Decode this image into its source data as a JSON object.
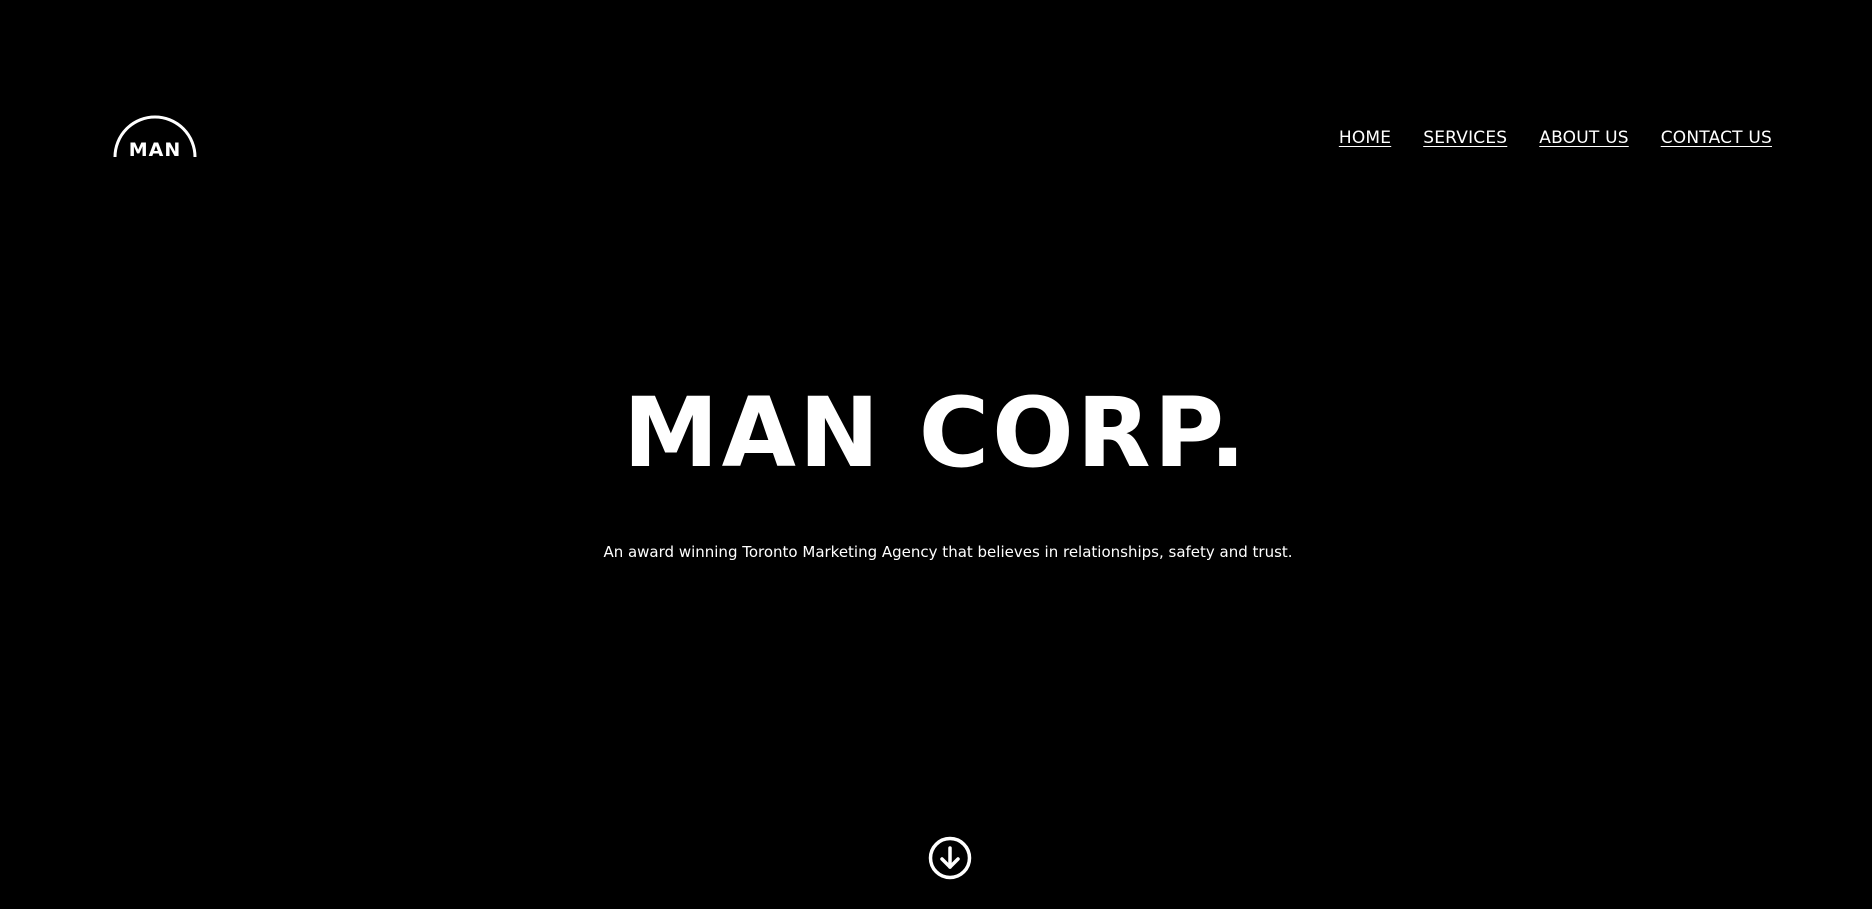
{
  "brand": {
    "logo_text": "MAN",
    "accent": "#ffffff",
    "background": "#000000"
  },
  "nav": {
    "items": [
      {
        "label": "HOME"
      },
      {
        "label": "SERVICES"
      },
      {
        "label": "ABOUT US"
      },
      {
        "label": "CONTACT US"
      }
    ]
  },
  "hero": {
    "title": "MAN CORP.",
    "subtitle": "An award winning Toronto Marketing Agency that believes in relationships, safety and trust."
  },
  "scroll": {
    "icon": "arrow-down-circle-icon"
  }
}
